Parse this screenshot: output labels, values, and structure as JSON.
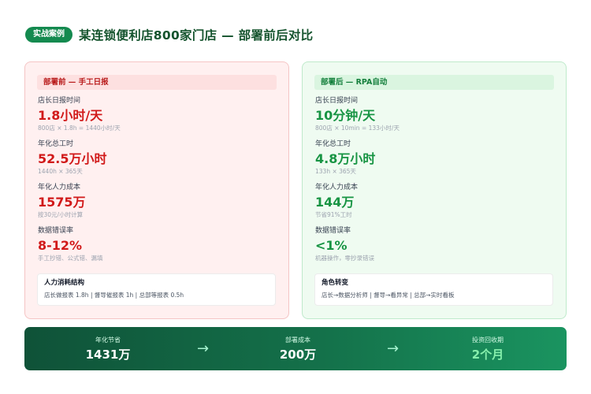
{
  "header": {
    "tag": "实战案例",
    "title": "某连锁便利店800家门店 — 部署前后对比"
  },
  "before": {
    "heading": "部署前 — 手工日报",
    "metrics": [
      {
        "label": "店长日报时间",
        "value": "1.8小时/天",
        "note": "800店 × 1.8h = 1440小时/天"
      },
      {
        "label": "年化总工时",
        "value": "52.5万小时",
        "note": "1440h × 365天"
      },
      {
        "label": "年化人力成本",
        "value": "1575万",
        "note": "按30元/小时计算"
      },
      {
        "label": "数据错误率",
        "value": "8-12%",
        "note": "手工抄错、公式错、漏填"
      }
    ],
    "box": {
      "title": "人力消耗结构",
      "text": "店长做报表 1.8h | 督导催报表 1h | 总部等报表 0.5h"
    }
  },
  "after": {
    "heading": "部署后 — RPA自动",
    "metrics": [
      {
        "label": "店长日报时间",
        "value": "10分钟/天",
        "note": "800店 × 10min = 133小时/天"
      },
      {
        "label": "年化总工时",
        "value": "4.8万小时",
        "note": "133h × 365天"
      },
      {
        "label": "年化人力成本",
        "value": "144万",
        "note": "节省91%工时"
      },
      {
        "label": "数据错误率",
        "value": "<1%",
        "note": "机器操作，零抄录错误"
      }
    ],
    "box": {
      "title": "角色转变",
      "text": "店长→数据分析师 | 督导→看异常 | 总部→实时看板"
    }
  },
  "footer": {
    "items": [
      {
        "label": "年化节省",
        "value": "1431万"
      },
      {
        "label": "部署成本",
        "value": "200万"
      },
      {
        "label": "投资回收期",
        "value": "2个月"
      }
    ],
    "arrow": "→"
  },
  "colors": {
    "brand_green": "#148a4f",
    "before_red": "#d11a1a",
    "after_green": "#179443",
    "payback_accent": "#86efac"
  }
}
